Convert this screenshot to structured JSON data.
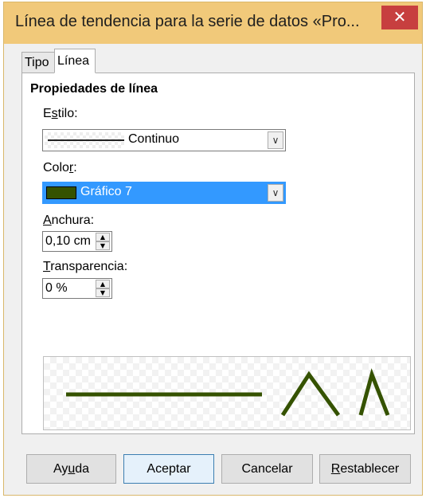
{
  "window": {
    "title": "Línea de tendencia para la serie de datos «Pro...",
    "close_glyph": "✕"
  },
  "tabs": [
    {
      "label": "Tipo",
      "active": false
    },
    {
      "label": "Línea",
      "active": true
    }
  ],
  "section": {
    "title": "Propiedades de línea"
  },
  "style": {
    "label_pre": "E",
    "label_u": "s",
    "label_post": "tilo:",
    "value": "Continuo"
  },
  "color": {
    "label_pre": "Colo",
    "label_u": "r",
    "label_post": ":",
    "value": "Gráfico 7",
    "swatch_hex": "#355200"
  },
  "width": {
    "label_u": "A",
    "label_post": "nchura:",
    "value": "0,10 cm"
  },
  "transparency": {
    "label_u": "T",
    "label_post": "ransparencia:",
    "value": "0 %"
  },
  "buttons": {
    "help_pre": "Ay",
    "help_u": "u",
    "help_post": "da",
    "ok": "Aceptar",
    "cancel": "Cancelar",
    "reset_u": "R",
    "reset_post": "establecer"
  },
  "colors": {
    "titlebar": "#f1c97a",
    "close_button": "#c73f3f",
    "selection": "#3399ff",
    "trendline": "#355200"
  }
}
